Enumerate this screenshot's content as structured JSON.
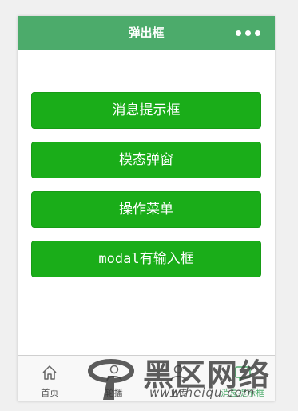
{
  "navbar": {
    "title": "弹出框",
    "more_icon": "more-dots-icon",
    "background": "#4cab6b"
  },
  "buttons": [
    {
      "label": "消息提示框"
    },
    {
      "label": "模态弹窗"
    },
    {
      "label": "操作菜单"
    },
    {
      "label": "modal有输入框"
    }
  ],
  "button_color": "#1aad19",
  "tabbar": {
    "items": [
      {
        "label": "首页",
        "icon": "home-icon",
        "active": false
      },
      {
        "label": "轮播",
        "icon": "user-icon",
        "active": false
      },
      {
        "label": "上传",
        "icon": "user-icon",
        "active": false
      },
      {
        "label": "消息提示框",
        "icon": "message-icon",
        "active": true
      }
    ],
    "active_color": "#4cab6b"
  },
  "watermark": {
    "text": "黑区网络",
    "url": "www.heiqu.com"
  }
}
